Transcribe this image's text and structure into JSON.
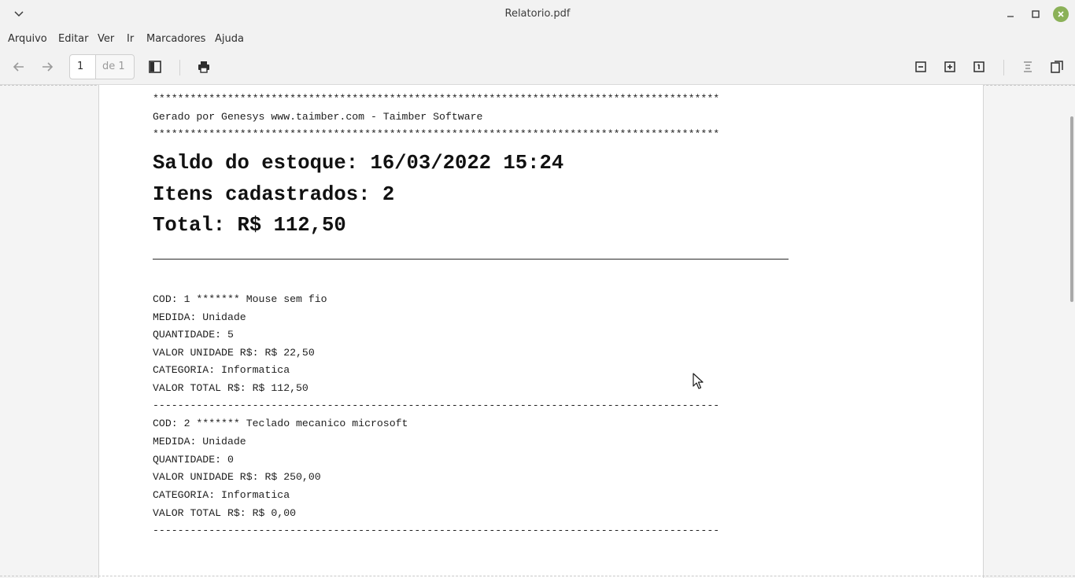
{
  "window": {
    "title": "Relatorio.pdf"
  },
  "menu": [
    "Arquivo",
    "Editar",
    "Ver",
    "Ir",
    "Marcadores",
    "Ajuda"
  ],
  "toolbar": {
    "current_page": "1",
    "page_of": "de 1"
  },
  "document": {
    "stars": "*******************************************************************************************",
    "generated_by": "Gerado por Genesys www.taimber.com - Taimber Software",
    "heading_saldo": "Saldo do estoque: 16/03/2022 15:24",
    "heading_itens": "Itens cadastrados: 2",
    "heading_total": "Total: R$ 112,50",
    "separator": "-------------------------------------------------------------------------------------------",
    "items": [
      {
        "cod": "COD: 1 ******* Mouse sem fio",
        "medida": "MEDIDA: Unidade",
        "quantidade": "QUANTIDADE: 5",
        "valor_unidade": "VALOR UNIDADE R$: R$ 22,50",
        "categoria": "CATEGORIA: Informatica",
        "valor_total": "VALOR TOTAL R$: R$ 112,50"
      },
      {
        "cod": "COD: 2 ******* Teclado mecanico microsoft",
        "medida": "MEDIDA: Unidade",
        "quantidade": "QUANTIDADE: 0",
        "valor_unidade": "VALOR UNIDADE R$: R$ 250,00",
        "categoria": "CATEGORIA: Informatica",
        "valor_total": "VALOR TOTAL R$: R$ 0,00"
      }
    ]
  }
}
